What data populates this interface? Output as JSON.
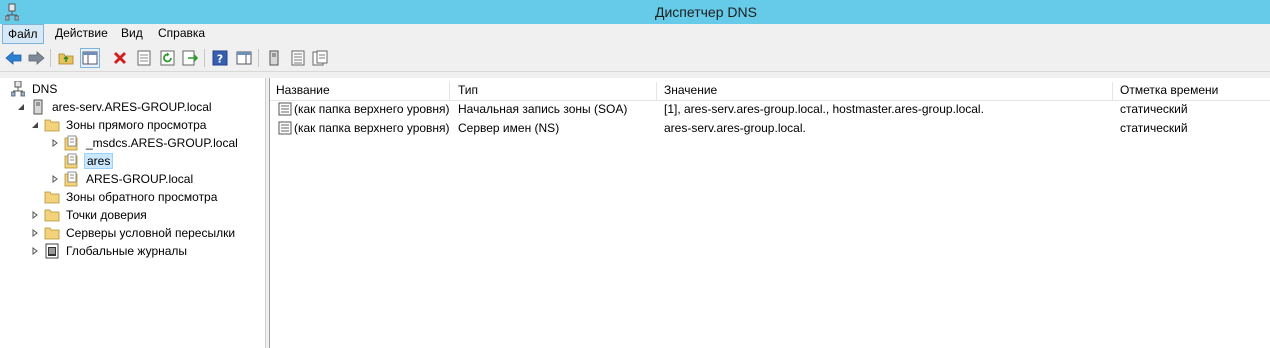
{
  "window": {
    "title": "Диспетчер DNS"
  },
  "menu": {
    "items": [
      {
        "label": "Файл"
      },
      {
        "label": "Действие"
      },
      {
        "label": "Вид"
      },
      {
        "label": "Справка"
      }
    ]
  },
  "toolbar": {
    "buttons": [
      "back-icon",
      "forward-icon",
      "up-folder-icon",
      "show-hide-tree-icon",
      "delete-icon",
      "properties-icon",
      "refresh-icon",
      "export-list-icon",
      "help-icon",
      "action-pane-icon",
      "server-icon",
      "record-list-icon",
      "new-record-icon"
    ]
  },
  "tree": {
    "root": "DNS",
    "server": "ares-serv.ARES-GROUP.local",
    "forward_zones": "Зоны прямого просмотра",
    "msdcs": "_msdcs.ARES-GROUP.local",
    "ares": "ares",
    "ares_group": "ARES-GROUP.local",
    "reverse_zones": "Зоны обратного просмотра",
    "trust_points": "Точки доверия",
    "conditional_forwarders": "Серверы условной пересылки",
    "global_logs": "Глобальные журналы"
  },
  "table": {
    "columns": [
      "Название",
      "Тип",
      "Значение",
      "Отметка времени"
    ],
    "rows": [
      {
        "name": "(как папка верхнего уровня)",
        "type": "Начальная запись зоны (SOA)",
        "value": "[1], ares-serv.ares-group.local., hostmaster.ares-group.local.",
        "timestamp": "статический"
      },
      {
        "name": "(как папка верхнего уровня)",
        "type": "Сервер имен (NS)",
        "value": "ares-serv.ares-group.local.",
        "timestamp": "статический"
      }
    ]
  },
  "colors": {
    "titlebar": "#65cbe9",
    "chrome": "#f0f0f0",
    "selection": "#cce8ff"
  }
}
